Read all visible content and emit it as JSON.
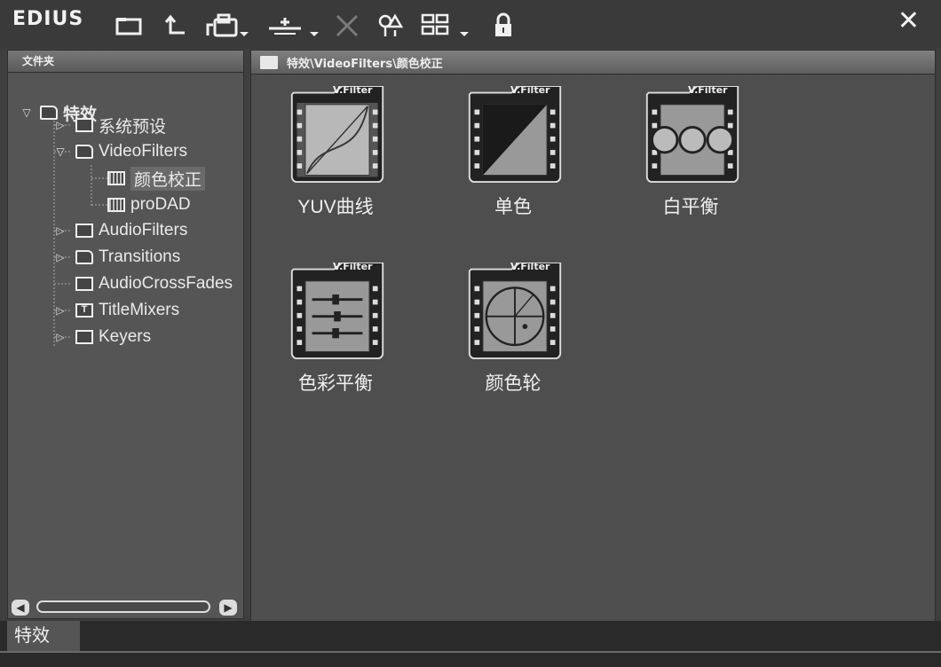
{
  "app": {
    "title": "EDIUS"
  },
  "toolbar": {
    "icons": [
      "new-folder-icon",
      "up-folder-icon",
      "copy-icon",
      "import-icon",
      "delete-icon",
      "properties-icon",
      "view-mode-icon",
      "lock-icon"
    ]
  },
  "left_panel": {
    "header": "文件夹",
    "tree": [
      {
        "label": "特效",
        "level": 0,
        "expanded": true
      },
      {
        "label": "系统预设",
        "level": 1
      },
      {
        "label": "VideoFilters",
        "level": 1,
        "expanded": true
      },
      {
        "label": "颜色校正",
        "level": 2,
        "selected": true
      },
      {
        "label": "proDAD",
        "level": 2
      },
      {
        "label": "AudioFilters",
        "level": 1
      },
      {
        "label": "Transitions",
        "level": 1
      },
      {
        "label": "AudioCrossFades",
        "level": 1
      },
      {
        "label": "TitleMixers",
        "level": 1
      },
      {
        "label": "Keyers",
        "level": 1
      }
    ]
  },
  "right_panel": {
    "path": "特效\\VideoFilters\\颜色校正",
    "badge": "V.Filter",
    "items": [
      {
        "label": "YUV曲线",
        "icon": "yuv-curve-icon"
      },
      {
        "label": "单色",
        "icon": "monochrome-icon"
      },
      {
        "label": "白平衡",
        "icon": "white-balance-icon"
      },
      {
        "label": "色彩平衡",
        "icon": "color-balance-icon"
      },
      {
        "label": "颜色轮",
        "icon": "color-wheel-icon"
      }
    ]
  },
  "bottom": {
    "tab": "特效"
  }
}
